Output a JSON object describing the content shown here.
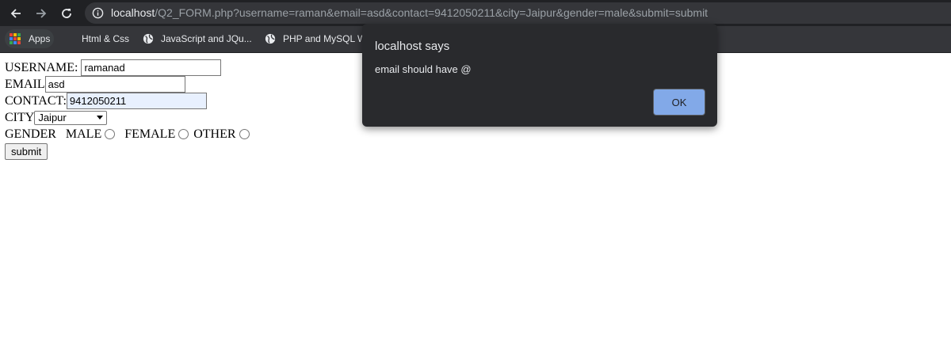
{
  "browser": {
    "url_host": "localhost",
    "url_path": "/Q2_FORM.php?username=raman&email=asd&contact=9412050211&city=Jaipur&gender=male&submit=submit",
    "bookmarks": [
      {
        "label": "Apps",
        "icon": "apps-grid-icon"
      },
      {
        "label": "Html & Css",
        "icon": ""
      },
      {
        "label": "JavaScript and JQu...",
        "icon": "globe-icon"
      },
      {
        "label": "PHP and MySQL W",
        "icon": "globe-icon"
      }
    ]
  },
  "form": {
    "username_label": "USERNAME:",
    "username_value": "ramanad",
    "email_label": "EMAIL",
    "email_value": "asd",
    "contact_label": "CONTACT:",
    "contact_value": "9412050211",
    "city_label": "CITY",
    "city_value": "Jaipur",
    "gender_label": "GENDER",
    "male_label": "MALE",
    "female_label": "FEMALE",
    "other_label": "OTHER",
    "submit_label": "submit"
  },
  "dialog": {
    "title": "localhost says",
    "message": "email should have @",
    "ok_label": "OK"
  },
  "colors": {
    "toolbar_bg": "#202124",
    "bookmarks_bg": "#35363a",
    "dialog_bg": "#292a2d",
    "ok_button": "#8ab4f8"
  }
}
